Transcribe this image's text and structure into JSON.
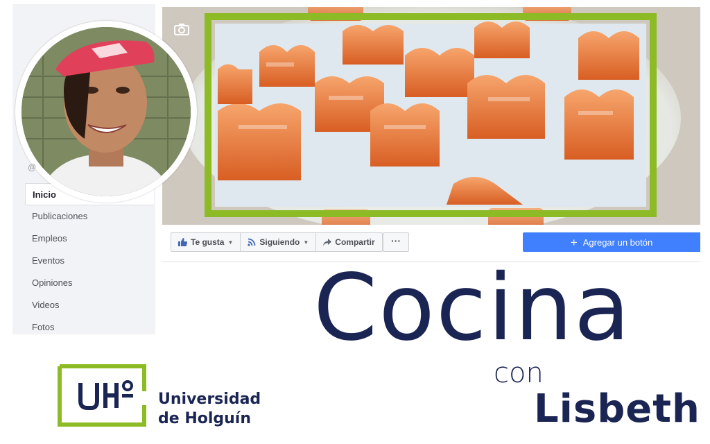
{
  "sidebar": {
    "items": [
      {
        "label": "Inicio"
      },
      {
        "label": "Publicaciones"
      },
      {
        "label": "Empleos"
      },
      {
        "label": "Eventos"
      },
      {
        "label": "Opiniones"
      },
      {
        "label": "Videos"
      },
      {
        "label": "Fotos"
      }
    ],
    "active_index": 0
  },
  "actions": {
    "like_label": "Te gusta",
    "following_label": "Siguiendo",
    "share_label": "Compartir",
    "more_label": "···",
    "add_button_label": "Agregar un botón"
  },
  "title": {
    "main": "Cocina",
    "connector": "con",
    "name": "Lisbeth"
  },
  "logo": {
    "line1": "Universidad",
    "line2": "de Holguín",
    "mark": "UH°"
  },
  "colors": {
    "accent_blue": "#4080ff",
    "facebook_blue": "#4267b2",
    "title_navy": "#1b2553",
    "logo_green": "#8dbb25",
    "sidebar_bg": "#f2f3f6"
  },
  "icons": {
    "camera": "camera-icon",
    "like": "thumbs-up-icon",
    "following": "rss-icon",
    "share": "share-arrow-icon",
    "add": "plus-icon"
  }
}
